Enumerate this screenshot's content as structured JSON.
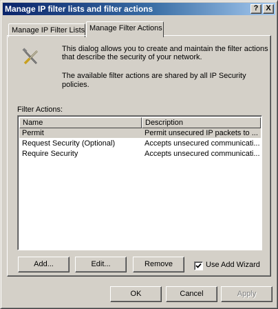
{
  "window": {
    "title": "Manage IP filter lists and filter actions",
    "help_label": "?",
    "close_label": "X"
  },
  "tabs": [
    {
      "label": "Manage IP Filter Lists",
      "active": false
    },
    {
      "label": "Manage Filter Actions",
      "active": true
    }
  ],
  "intro": {
    "icon": "wrench-screwdriver-icon",
    "line1": "This dialog allows you to create and maintain the filter actions",
    "line2": "that describe the security of your network.",
    "line3": "The available filter actions are shared by all IP Security",
    "line4": "policies."
  },
  "filter_actions": {
    "label": "Filter Actions:",
    "columns": [
      "Name",
      "Description"
    ],
    "rows": [
      {
        "name": "Permit",
        "description": "Permit unsecured IP packets to ...",
        "selected": true
      },
      {
        "name": "Request Security (Optional)",
        "description": "Accepts unsecured communicati...",
        "selected": false
      },
      {
        "name": "Require Security",
        "description": "Accepts unsecured communicati...",
        "selected": false
      }
    ]
  },
  "actions": {
    "add_label": "Add...",
    "edit_label": "Edit...",
    "remove_label": "Remove",
    "wizard_label": "Use Add Wizard",
    "wizard_checked": true
  },
  "footer": {
    "ok_label": "OK",
    "cancel_label": "Cancel",
    "apply_label": "Apply",
    "apply_enabled": false
  }
}
